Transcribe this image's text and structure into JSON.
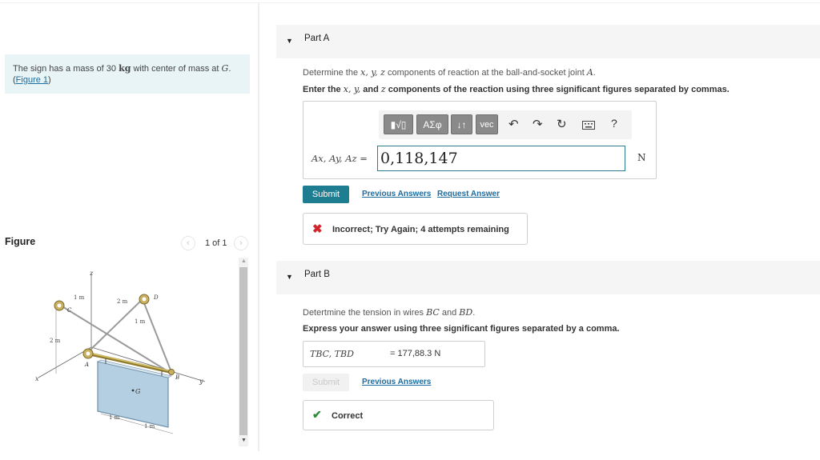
{
  "problem": {
    "text_prefix": "The sign has a mass of 30",
    "mass_unit": "kg",
    "text_mid": "with center of mass at",
    "cm_symbol": "G",
    "link_text": "Figure 1",
    "link_open": "(",
    "link_close": ")"
  },
  "figure_panel": {
    "heading": "Figure",
    "counter": "1 of 1",
    "prev_icon": "chevron-left-icon",
    "next_icon": "chevron-right-icon",
    "labels": {
      "z": "z",
      "y": "y",
      "x": "x",
      "A": "A",
      "B": "B",
      "C": "C",
      "D": "D",
      "G": "G",
      "dim_1m_top": "1 m",
      "dim_2m_top": "2 m",
      "dim_1m_right": "1 m",
      "dim_2m_left": "2 m",
      "dim_1m_bottom_left": "1 m",
      "dim_1m_bottom_right": "1 m"
    }
  },
  "part_a": {
    "title": "Part A",
    "question_prefix": "Determine the",
    "question_vars": "x, y, z",
    "question_mid": "components of reaction at the ball-and-socket joint",
    "question_point": "A",
    "question_end": ".",
    "instruction_prefix": "Enter the",
    "instruction_vars": "x, y,",
    "instruction_and": "and",
    "instruction_z": "z",
    "instruction_suffix": "components of the reaction using three significant figures separated by commas.",
    "toolbar": {
      "templates_label": "▮√▯",
      "greek_label": "ΑΣφ",
      "arrows_label": "↓↑",
      "vec_label": "vec",
      "undo_icon": "undo-icon",
      "redo_icon": "redo-icon",
      "reset_icon": "reset-icon",
      "keyboard_icon": "keyboard-icon",
      "help_label": "?"
    },
    "answer_label": "Ax, Ay, Az =",
    "answer_value": "0,118,147",
    "units": "N",
    "submit_label": "Submit",
    "previous_answers_label": "Previous Answers",
    "request_answer_label": "Request Answer",
    "feedback_text": "Incorrect; Try Again; 4 attempts remaining",
    "feedback_icon": "x-icon",
    "feedback_color": "#d4232b"
  },
  "part_b": {
    "title": "Part B",
    "question_prefix": "Detertmine the tension in wires",
    "question_bc": "BC",
    "question_and": "and",
    "question_bd": "BD",
    "question_end": ".",
    "instruction": "Express your answer using three significant figures separated by a comma.",
    "answer_label": "TBC, TBD",
    "answer_value": "= 177,88.3  N",
    "submit_label": "Submit",
    "previous_answers_label": "Previous Answers",
    "feedback_text": "Correct",
    "feedback_icon": "check-icon",
    "feedback_color": "#2e8b3a"
  },
  "colors": {
    "accent": "#1f7d92",
    "link": "#1a6ca1",
    "problem_bg": "#e8f4f6"
  }
}
